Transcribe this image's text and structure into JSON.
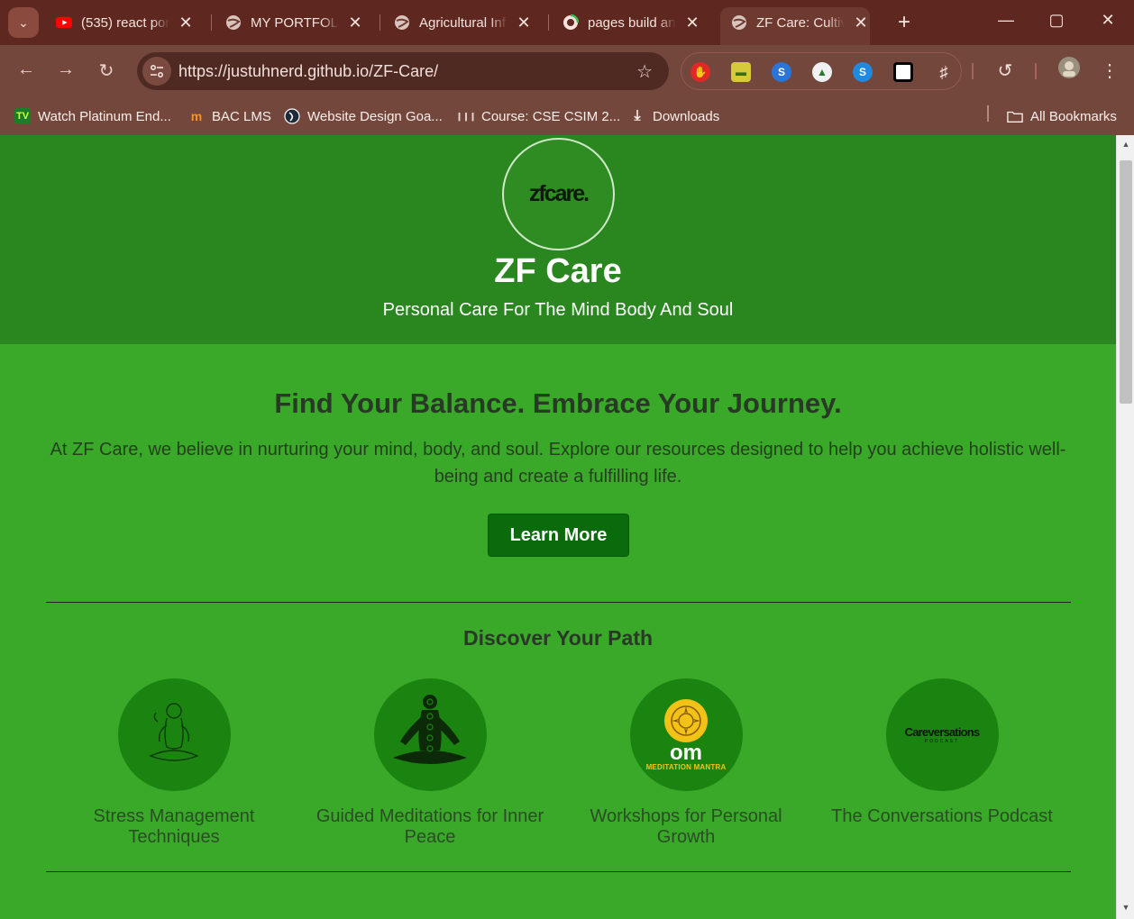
{
  "browser": {
    "tabs": [
      {
        "title": "(535) react por",
        "icon": "youtube-icon"
      },
      {
        "title": "MY PORTFOLIO",
        "icon": "globe-icon"
      },
      {
        "title": "Agricultural Inf",
        "icon": "globe-icon"
      },
      {
        "title": "pages build an",
        "icon": "github-icon"
      },
      {
        "title": "ZF Care: Cultiv",
        "icon": "globe-icon",
        "active": true
      }
    ],
    "url": "https://justuhnerd.github.io/ZF-Care/",
    "bookmarks": [
      {
        "label": "Watch Platinum End...",
        "icon": "tv-icon"
      },
      {
        "label": "BAC LMS",
        "icon": "moodle-icon"
      },
      {
        "label": "Website Design Goa...",
        "icon": "site-icon"
      },
      {
        "label": "Course: CSE CSIM 2...",
        "icon": "cisco-icon"
      },
      {
        "label": "Downloads",
        "icon": "download-icon"
      }
    ],
    "all_bookmarks": "All Bookmarks"
  },
  "page": {
    "logo_text": "zfcare.",
    "title": "ZF Care",
    "subtitle": "Personal Care For The Mind Body And Soul",
    "headline": "Find Your Balance. Embrace Your Journey.",
    "intro": "At ZF Care, we believe in nurturing your mind, body, and soul. Explore our resources designed to help you achieve holistic well-being and create a fulfilling life.",
    "cta": "Learn More",
    "section_title": "Discover Your Path",
    "cards": [
      {
        "label": "Stress Management Techniques"
      },
      {
        "label": "Guided Meditations for Inner Peace"
      },
      {
        "label": "Workshops for Personal Growth",
        "badge_main": "om",
        "badge_sub": "MEDITATION MANTRA"
      },
      {
        "label": "The Conversations Podcast",
        "badge_main": "Careversations",
        "badge_sub": "PODCAST"
      }
    ]
  },
  "colors": {
    "chrome": "#74473d",
    "hero": "#2a861f",
    "body": "#3aa829",
    "button": "#0a6b0d"
  }
}
